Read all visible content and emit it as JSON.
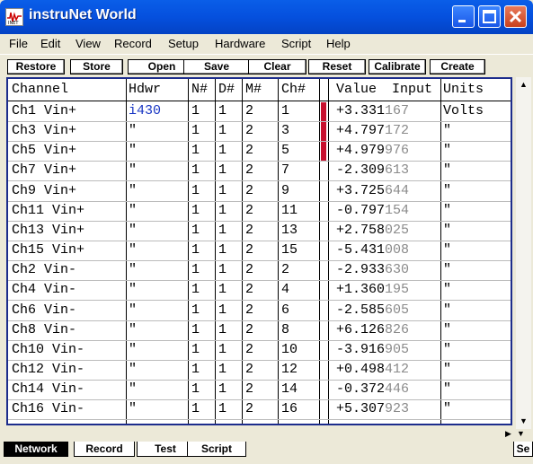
{
  "window": {
    "title": "instruNet World"
  },
  "menu": [
    "File",
    "Edit",
    "View",
    "Record",
    "Setup",
    "Hardware",
    "Script",
    "Help"
  ],
  "toolbar": [
    "Restore",
    "Store",
    "Open",
    "Save",
    "Clear",
    "Reset",
    "Calibrate",
    "Create"
  ],
  "table": {
    "headers": {
      "channel": "Channel",
      "hdwr": "Hdwr",
      "n": "N#",
      "d": "D#",
      "m": "M#",
      "ch": "Ch#",
      "value": "Value",
      "input": "Input",
      "units": "Units"
    },
    "rows": [
      {
        "channel": "Ch1 Vin+",
        "hdwr": "i430",
        "n": "1",
        "d": "1",
        "m": "2",
        "ch": "1",
        "value": "+3.331",
        "input": "167",
        "units": "Volts"
      },
      {
        "channel": "Ch3 Vin+",
        "hdwr": "\"",
        "n": "1",
        "d": "1",
        "m": "2",
        "ch": "3",
        "value": "+4.797",
        "input": "172",
        "units": "\""
      },
      {
        "channel": "Ch5 Vin+",
        "hdwr": "\"",
        "n": "1",
        "d": "1",
        "m": "2",
        "ch": "5",
        "value": "+4.979",
        "input": "976",
        "units": "\""
      },
      {
        "channel": "Ch7 Vin+",
        "hdwr": "\"",
        "n": "1",
        "d": "1",
        "m": "2",
        "ch": "7",
        "value": "-2.309",
        "input": "613",
        "units": "\""
      },
      {
        "channel": "Ch9 Vin+",
        "hdwr": "\"",
        "n": "1",
        "d": "1",
        "m": "2",
        "ch": "9",
        "value": "+3.725",
        "input": "644",
        "units": "\""
      },
      {
        "channel": "Ch11 Vin+",
        "hdwr": "\"",
        "n": "1",
        "d": "1",
        "m": "2",
        "ch": "11",
        "value": "-0.797",
        "input": "154",
        "units": "\""
      },
      {
        "channel": "Ch13 Vin+",
        "hdwr": "\"",
        "n": "1",
        "d": "1",
        "m": "2",
        "ch": "13",
        "value": "+2.758",
        "input": "025",
        "units": "\""
      },
      {
        "channel": "Ch15 Vin+",
        "hdwr": "\"",
        "n": "1",
        "d": "1",
        "m": "2",
        "ch": "15",
        "value": "-5.431",
        "input": "008",
        "units": "\""
      },
      {
        "channel": "Ch2 Vin-",
        "hdwr": "\"",
        "n": "1",
        "d": "1",
        "m": "2",
        "ch": "2",
        "value": "-2.933",
        "input": "630",
        "units": "\""
      },
      {
        "channel": "Ch4 Vin-",
        "hdwr": "\"",
        "n": "1",
        "d": "1",
        "m": "2",
        "ch": "4",
        "value": "+1.360",
        "input": "195",
        "units": "\""
      },
      {
        "channel": "Ch6 Vin-",
        "hdwr": "\"",
        "n": "1",
        "d": "1",
        "m": "2",
        "ch": "6",
        "value": "-2.585",
        "input": "605",
        "units": "\""
      },
      {
        "channel": "Ch8 Vin-",
        "hdwr": "\"",
        "n": "1",
        "d": "1",
        "m": "2",
        "ch": "8",
        "value": "+6.126",
        "input": "826",
        "units": "\""
      },
      {
        "channel": "Ch10 Vin-",
        "hdwr": "\"",
        "n": "1",
        "d": "1",
        "m": "2",
        "ch": "10",
        "value": "-3.916",
        "input": "905",
        "units": "\""
      },
      {
        "channel": "Ch12 Vin-",
        "hdwr": "\"",
        "n": "1",
        "d": "1",
        "m": "2",
        "ch": "12",
        "value": "+0.498",
        "input": "412",
        "units": "\""
      },
      {
        "channel": "Ch14 Vin-",
        "hdwr": "\"",
        "n": "1",
        "d": "1",
        "m": "2",
        "ch": "14",
        "value": "-0.372",
        "input": "446",
        "units": "\""
      },
      {
        "channel": "Ch16 Vin-",
        "hdwr": "\"",
        "n": "1",
        "d": "1",
        "m": "2",
        "ch": "16",
        "value": "+5.307",
        "input": "923",
        "units": "\""
      }
    ]
  },
  "tabs": [
    "Network",
    "Record",
    "Test",
    "Script",
    "Se"
  ],
  "colors": {
    "marker": "#c8102e",
    "border": "#1c2c8c",
    "link": "#1a37c4"
  }
}
